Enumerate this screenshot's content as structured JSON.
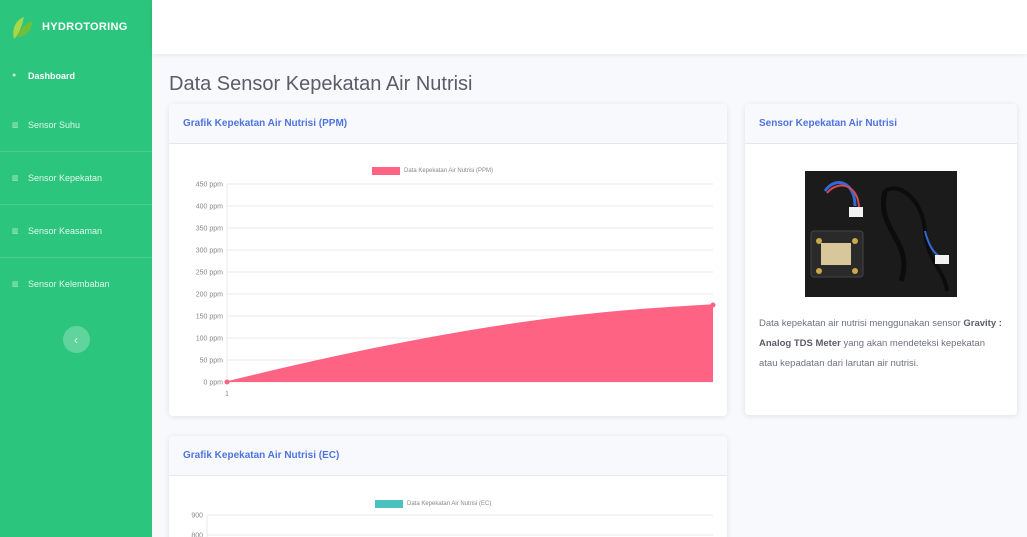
{
  "brand": {
    "name": "HYDROTORING"
  },
  "sidebar": {
    "items": [
      {
        "label": "Dashboard",
        "icon": "tachometer-icon"
      },
      {
        "label": "Sensor Suhu",
        "icon": "chart-icon"
      },
      {
        "label": "Sensor Kepekatan",
        "icon": "chart-icon"
      },
      {
        "label": "Sensor Keasaman",
        "icon": "chart-icon"
      },
      {
        "label": "Sensor Kelembaban",
        "icon": "chart-icon"
      }
    ],
    "toggle_icon": "chevron-left-icon"
  },
  "page": {
    "title": "Data Sensor Kepekatan Air Nutrisi"
  },
  "ppm_card": {
    "title": "Grafik Kepekatan Air Nutrisi (PPM)",
    "legend": "Data Kepekatan Air Nutrisi (PPM)",
    "color": "#ff6384"
  },
  "ec_card": {
    "title": "Grafik Kepekatan Air Nutrisi (EC)",
    "legend": "Data Kepekatan Air Nutrisi (EC)",
    "color": "#4bc0c0"
  },
  "sensor_card": {
    "title": "Sensor Kepekatan Air Nutrisi",
    "desc_prefix": "Data kepekatan air nutrisi menggunakan sensor",
    "desc_bold": "Gravity : Analog TDS Meter",
    "desc_suffix": "yang akan mendeteksi kepekatan atau kepadatan dari larutan air nutrisi."
  },
  "chart_data": [
    {
      "type": "area",
      "title": "",
      "x": [
        1,
        2
      ],
      "series": [
        {
          "name": "Data Kepekatan Air Nutrisi (PPM)",
          "values": [
            0,
            175
          ]
        }
      ],
      "x_tick_labels": [
        "1"
      ],
      "y_ticks": [
        "0 ppm",
        "50 ppm",
        "100 ppm",
        "150 ppm",
        "200 ppm",
        "250 ppm",
        "300 ppm",
        "350 ppm",
        "400 ppm",
        "450 ppm"
      ],
      "ylim": [
        0,
        450
      ],
      "grid": true,
      "legend": "top"
    },
    {
      "type": "area",
      "title": "",
      "series": [
        {
          "name": "Data Kepekatan Air Nutrisi (EC)",
          "values": []
        }
      ],
      "y_ticks": [
        "900",
        "800"
      ],
      "ylim": [
        0,
        900
      ],
      "grid": true,
      "legend": "top"
    }
  ]
}
